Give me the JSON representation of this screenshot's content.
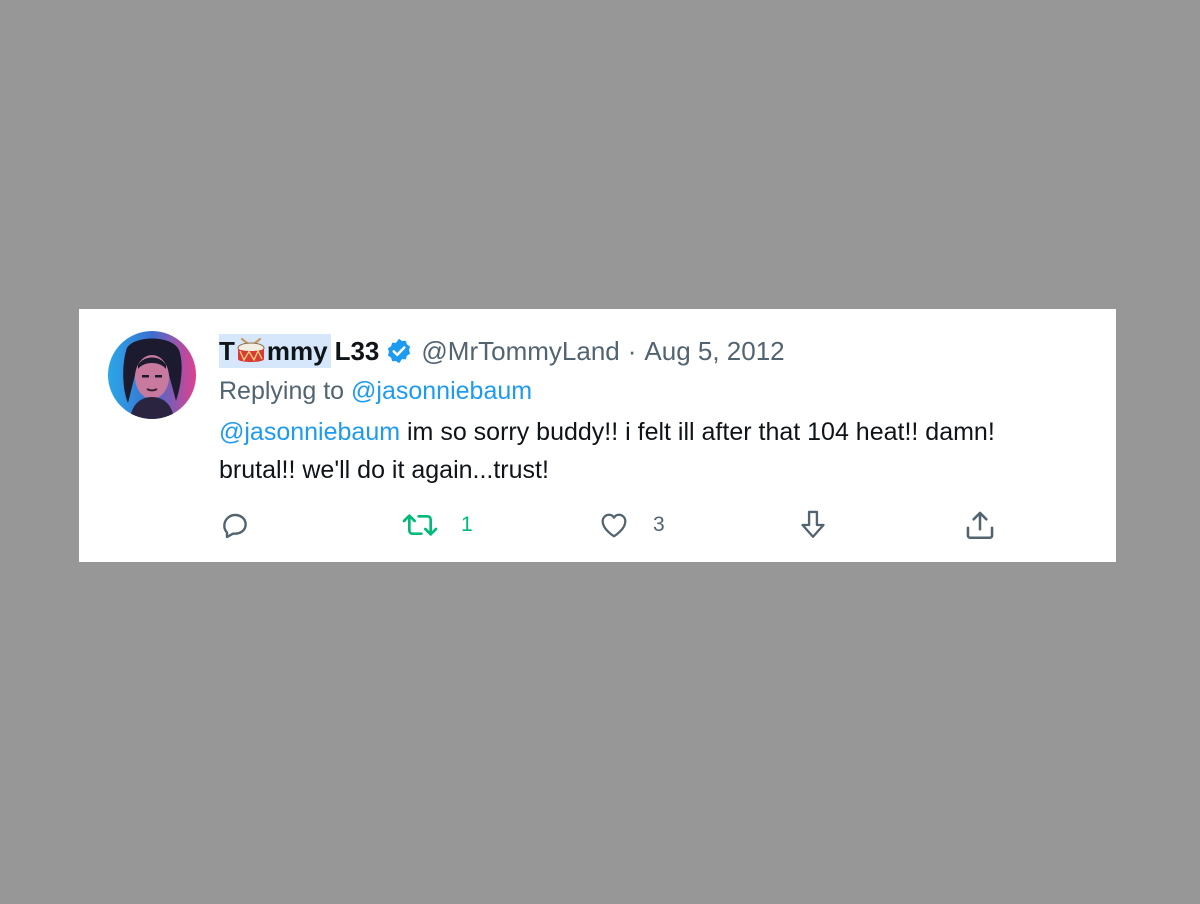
{
  "tweet": {
    "display_name_first": "T",
    "display_name_rest": "mmy",
    "display_name_suffix": "L33",
    "handle": "@MrTommyLand",
    "separator": "·",
    "date": "Aug 5, 2012",
    "reply_prefix": "Replying to",
    "reply_to": "@jasonniebaum",
    "text_mention": "@jasonniebaum",
    "text_line1": " im so sorry buddy!! i felt ill after that 104 heat!! damn!",
    "text_line2": "brutal!! we'll do it again...trust!"
  },
  "actions": {
    "reply": {
      "icon": "reply-icon"
    },
    "retweet": {
      "icon": "retweet-icon",
      "count": "1"
    },
    "like": {
      "icon": "heart-icon",
      "count": "3"
    },
    "bookmark": {
      "icon": "download-icon"
    },
    "share": {
      "icon": "share-icon"
    }
  },
  "colors": {
    "background": "#979797",
    "card": "#ffffff",
    "accent": "#1d9bf0",
    "retweet": "#00ba7c",
    "muted": "#536471",
    "name_highlight": "#d6e6fb"
  }
}
